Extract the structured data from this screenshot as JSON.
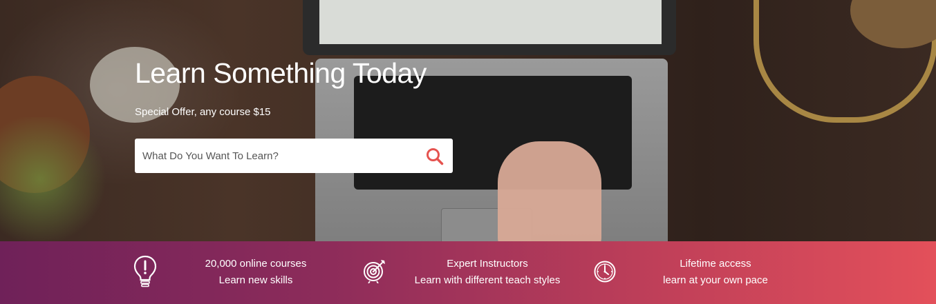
{
  "hero": {
    "title": "Learn Something Today",
    "subtitle": "Special Offer, any course $15",
    "search": {
      "placeholder": "What Do You Want To Learn?",
      "value": "",
      "button_icon": "search-icon"
    }
  },
  "features": [
    {
      "icon": "lightbulb-icon",
      "line1": "20,000 online courses",
      "line2": "Learn new skills"
    },
    {
      "icon": "target-icon",
      "line1": "Expert Instructors",
      "line2": "Learn with different teach styles"
    },
    {
      "icon": "clock-icon",
      "line1": "Lifetime access",
      "line2": "learn at your own pace"
    }
  ],
  "colors": {
    "accent": "#e5534f",
    "band_start": "#6f2159",
    "band_end": "#e3505a"
  }
}
